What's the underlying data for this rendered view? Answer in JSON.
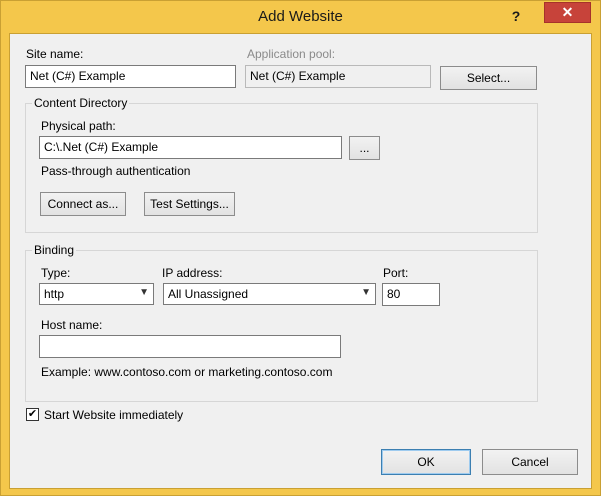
{
  "window": {
    "title": "Add Website",
    "help_glyph": "?",
    "close_glyph": "✕"
  },
  "site": {
    "site_name_label": "Site name:",
    "site_name_value": "Net (C#) Example",
    "app_pool_label": "Application pool:",
    "app_pool_value": "Net (C#) Example",
    "select_button": "Select..."
  },
  "content_directory": {
    "legend": "Content Directory",
    "physical_path_label": "Physical path:",
    "physical_path_value": "C:\\.Net (C#) Example",
    "browse_button": "...",
    "auth_text": "Pass-through authentication",
    "connect_as_button": "Connect as...",
    "test_settings_button": "Test Settings..."
  },
  "binding": {
    "legend": "Binding",
    "type_label": "Type:",
    "type_value": "http",
    "ip_label": "IP address:",
    "ip_value": "All Unassigned",
    "port_label": "Port:",
    "port_value": "80",
    "host_name_label": "Host name:",
    "host_name_value": "",
    "example_text": "Example: www.contoso.com or marketing.contoso.com"
  },
  "start_immediately": {
    "checked": true,
    "check_glyph": "✔",
    "label": "Start Website immediately"
  },
  "footer": {
    "ok_button": "OK",
    "cancel_button": "Cancel"
  }
}
